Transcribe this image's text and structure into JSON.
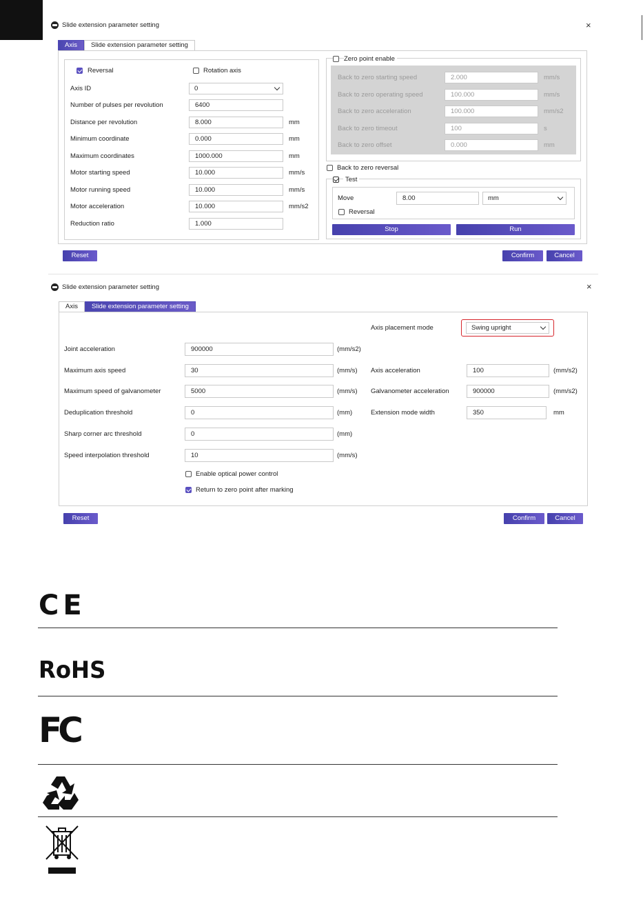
{
  "dialog1": {
    "title": "Slide extension parameter setting",
    "tabs": [
      {
        "label": "Axis"
      },
      {
        "label": "Slide extension parameter setting"
      }
    ],
    "reversal_label": "Reversal",
    "rotation_axis_label": "Rotation axis",
    "rows": [
      {
        "label": "Axis ID",
        "value": "0",
        "unit": ""
      },
      {
        "label": "Number of pulses per revolution",
        "value": "6400",
        "unit": ""
      },
      {
        "label": "Distance per revolution",
        "value": "8.000",
        "unit": "mm"
      },
      {
        "label": "Minimum coordinate",
        "value": "0.000",
        "unit": "mm"
      },
      {
        "label": "Maximum coordinates",
        "value": "1000.000",
        "unit": "mm"
      },
      {
        "label": "Motor starting speed",
        "value": "10.000",
        "unit": "mm/s"
      },
      {
        "label": "Motor running speed",
        "value": "10.000",
        "unit": "mm/s"
      },
      {
        "label": "Motor acceleration",
        "value": "10.000",
        "unit": "mm/s2"
      },
      {
        "label": "Reduction ratio",
        "value": "1.000",
        "unit": ""
      }
    ],
    "zero_point_enable_label": "Zero point enable",
    "zero_rows": [
      {
        "label": "Back to zero starting speed",
        "value": "2.000",
        "unit": "mm/s"
      },
      {
        "label": "Back to zero operating speed",
        "value": "100.000",
        "unit": "mm/s"
      },
      {
        "label": "Back to zero acceleration",
        "value": "100.000",
        "unit": "mm/s2"
      },
      {
        "label": "Back to zero timeout",
        "value": "100",
        "unit": "s"
      },
      {
        "label": "Back to zero offset",
        "value": "0.000",
        "unit": "mm"
      }
    ],
    "back_to_zero_reversal_label": "Back to zero reversal",
    "test_label": "Test",
    "move_label": "Move",
    "move_value": "8.00",
    "move_unit": "mm",
    "test_reversal_label": "Reversal",
    "stop_label": "Stop",
    "run_label": "Run",
    "reset_label": "Reset",
    "confirm_label": "Confirm",
    "cancel_label": "Cancel"
  },
  "dialog2": {
    "title": "Slide extension parameter setting",
    "tabs": [
      {
        "label": "Axis"
      },
      {
        "label": "Slide extension parameter setting"
      }
    ],
    "axis_placement_mode_label": "Axis placement mode",
    "axis_placement_mode_value": "Swing upright",
    "left_rows": [
      {
        "label": "Joint acceleration",
        "value": "900000",
        "unit": "(mm/s2)"
      },
      {
        "label": "Maximum axis speed",
        "value": "30",
        "unit": "(mm/s)"
      },
      {
        "label": "Maximum speed of galvanometer",
        "value": "5000",
        "unit": "(mm/s)"
      },
      {
        "label": "Deduplication threshold",
        "value": "0",
        "unit": "(mm)"
      },
      {
        "label": "Sharp corner arc threshold",
        "value": "0",
        "unit": "(mm)"
      },
      {
        "label": "Speed interpolation threshold",
        "value": "10",
        "unit": "(mm/s)"
      }
    ],
    "right_rows": [
      {
        "label": "Axis acceleration",
        "value": "100",
        "unit": "(mm/s2)"
      },
      {
        "label": "Galvanometer acceleration",
        "value": "900000",
        "unit": "(mm/s2)"
      },
      {
        "label": "Extension mode width",
        "value": "350",
        "unit": "mm"
      }
    ],
    "optical_power_label": "Enable optical power control",
    "return_zero_label": "Return to zero point after marking",
    "reset_label": "Reset",
    "confirm_label": "Confirm",
    "cancel_label": "Cancel"
  },
  "certifications": {
    "ce": "CE",
    "rohs": "RoHS",
    "fc": "FC"
  },
  "icons": {
    "dialog_logo": "app-logo-icon",
    "close": "close-icon",
    "dropdown": "chevron-down-icon",
    "recycle": "recycle-icon",
    "weee": "crossed-bin-icon"
  },
  "colors": {
    "accent": "#5a50c0",
    "highlight": "#d6242a"
  }
}
